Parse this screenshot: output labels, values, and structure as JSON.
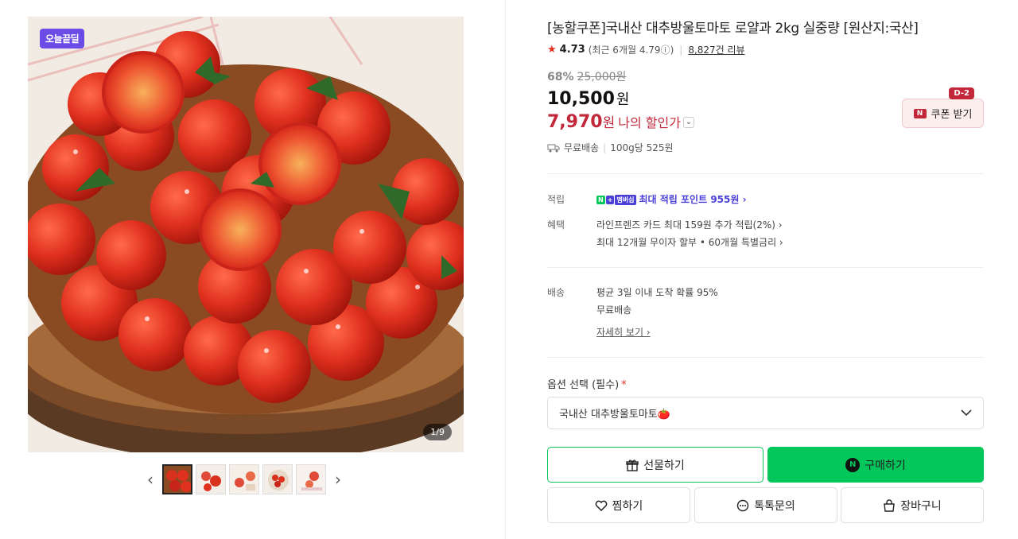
{
  "gallery": {
    "deal_badge": "오늘끝딜",
    "counter": "1/9",
    "prev": "‹",
    "next": "›",
    "thumbnail_count": 5
  },
  "product": {
    "title": "[농할쿠폰]국내산 대추방울토마토 로얄과 2kg 실중량 [원산지:국산]",
    "rating": "4.73",
    "rating_recent": "(최근 6개월 4.79",
    "rating_recent_info": "ⓘ",
    "rating_recent_close": ")",
    "review_count": "8,827건 리뷰",
    "discount_rate": "68%",
    "original_price": "25,000원",
    "price": "10,500",
    "price_unit": "원",
    "my_price": "7,970",
    "my_price_unit": "원",
    "my_price_label": "나의 할인가",
    "coupon_label": "쿠폰 받기",
    "coupon_dday": "D-2",
    "shipping": "무료배송",
    "unit_price": "100g당 525원"
  },
  "benefits": {
    "points_label": "적립",
    "points_badge": "멤버십",
    "points_text": "최대 적립 포인트 955원 ›",
    "benefit_label": "혜택",
    "benefit_1": "라인프렌즈 카드 최대 159원 추가 적립(2%) ›",
    "benefit_2": "최대 12개월 무이자 할부 • 60개월 특별금리 ›",
    "delivery_label": "배송",
    "delivery_1": "평균 3일 이내 도착 확률 95%",
    "delivery_2": "무료배송",
    "delivery_more": "자세히 보기 ›"
  },
  "options": {
    "label": "옵션 선택 (필수)",
    "required_mark": "*",
    "selected": "국내산 대추방울토마토🍅"
  },
  "actions": {
    "gift": "선물하기",
    "buy": "구매하기",
    "wish": "찜하기",
    "talk": "톡톡문의",
    "cart": "장바구니"
  },
  "colors": {
    "naver_green": "#03c75a",
    "price_red": "#c2273a",
    "deal_purple": "#6b4ce6"
  }
}
